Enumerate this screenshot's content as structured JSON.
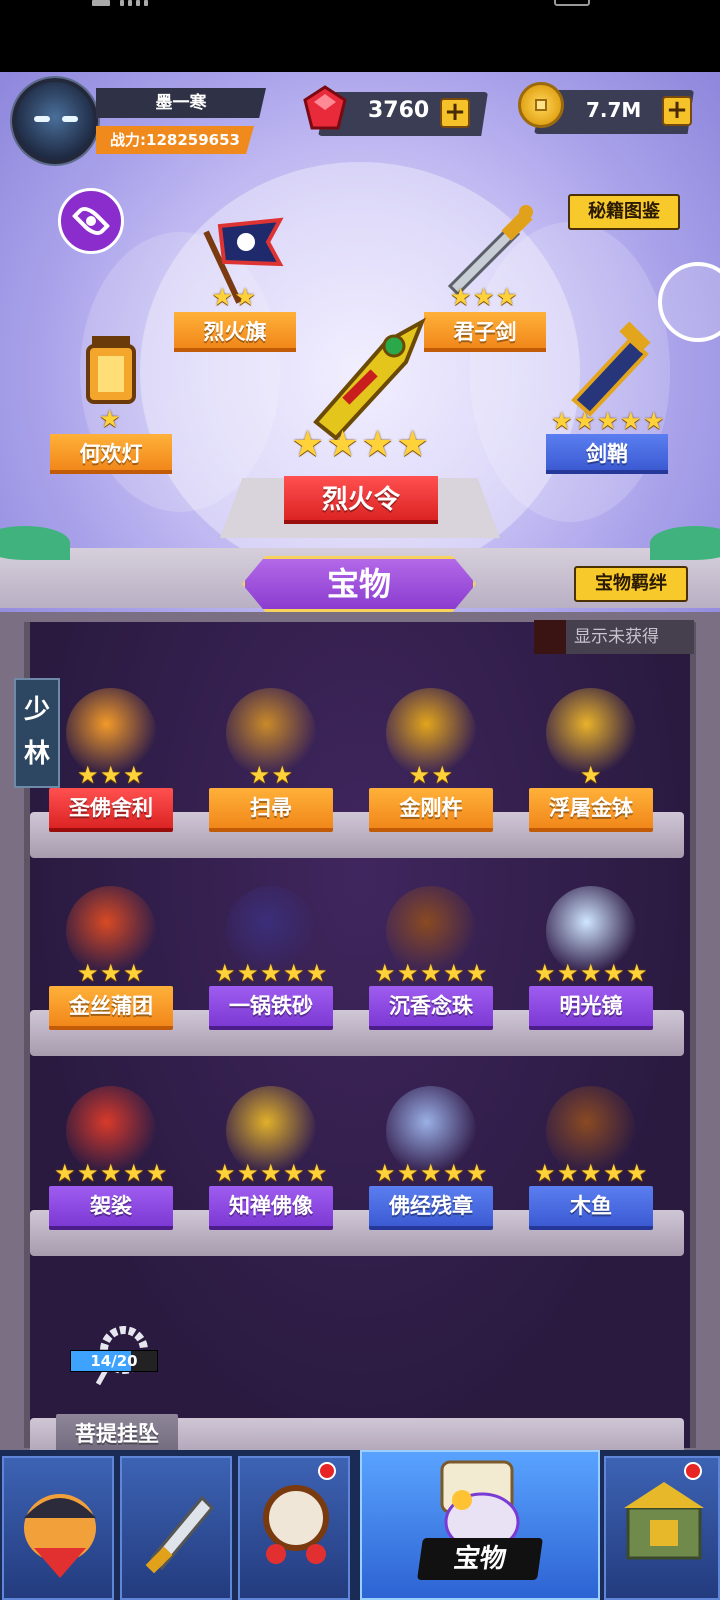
{
  "player": {
    "name": "墨一寒",
    "power_label": "战力:",
    "power_value": "128259653"
  },
  "resources": {
    "gems": "3760",
    "gold": "7.7M",
    "plus": "+"
  },
  "buttons": {
    "codex": "秘籍图鉴",
    "bond": "宝物羁绊",
    "show_unobtained": "显示未获得"
  },
  "equipped": [
    {
      "name": "烈火旗",
      "stars": 2,
      "color": "orange"
    },
    {
      "name": "君子剑",
      "stars": 3,
      "color": "orange"
    },
    {
      "name": "何欢灯",
      "stars": 1,
      "color": "orange"
    },
    {
      "name": "剑鞘",
      "stars": 5,
      "color": "blue"
    },
    {
      "name": "烈火令",
      "stars": 4,
      "color": "red"
    }
  ],
  "tab_title": "宝物",
  "category": "少林",
  "treasures": [
    {
      "name": "圣佛舍利",
      "stars": 3,
      "color": "red"
    },
    {
      "name": "扫帚",
      "stars": 2,
      "color": "orange"
    },
    {
      "name": "金刚杵",
      "stars": 2,
      "color": "orange"
    },
    {
      "name": "浮屠金钵",
      "stars": 1,
      "color": "orange"
    },
    {
      "name": "金丝蒲团",
      "stars": 3,
      "color": "orange"
    },
    {
      "name": "一锅铁砂",
      "stars": 5,
      "color": "purple"
    },
    {
      "name": "沉香念珠",
      "stars": 5,
      "color": "purple"
    },
    {
      "name": "明光镜",
      "stars": 5,
      "color": "purple"
    },
    {
      "name": "袈裟",
      "stars": 5,
      "color": "purple"
    },
    {
      "name": "知禅佛像",
      "stars": 5,
      "color": "purple"
    },
    {
      "name": "佛经残章",
      "stars": 5,
      "color": "blue"
    },
    {
      "name": "木鱼",
      "stars": 5,
      "color": "blue"
    }
  ],
  "locked_item": {
    "name": "菩提挂坠",
    "progress_text": "14/20",
    "progress": 0.7
  },
  "nav": {
    "active_label": "宝物"
  }
}
